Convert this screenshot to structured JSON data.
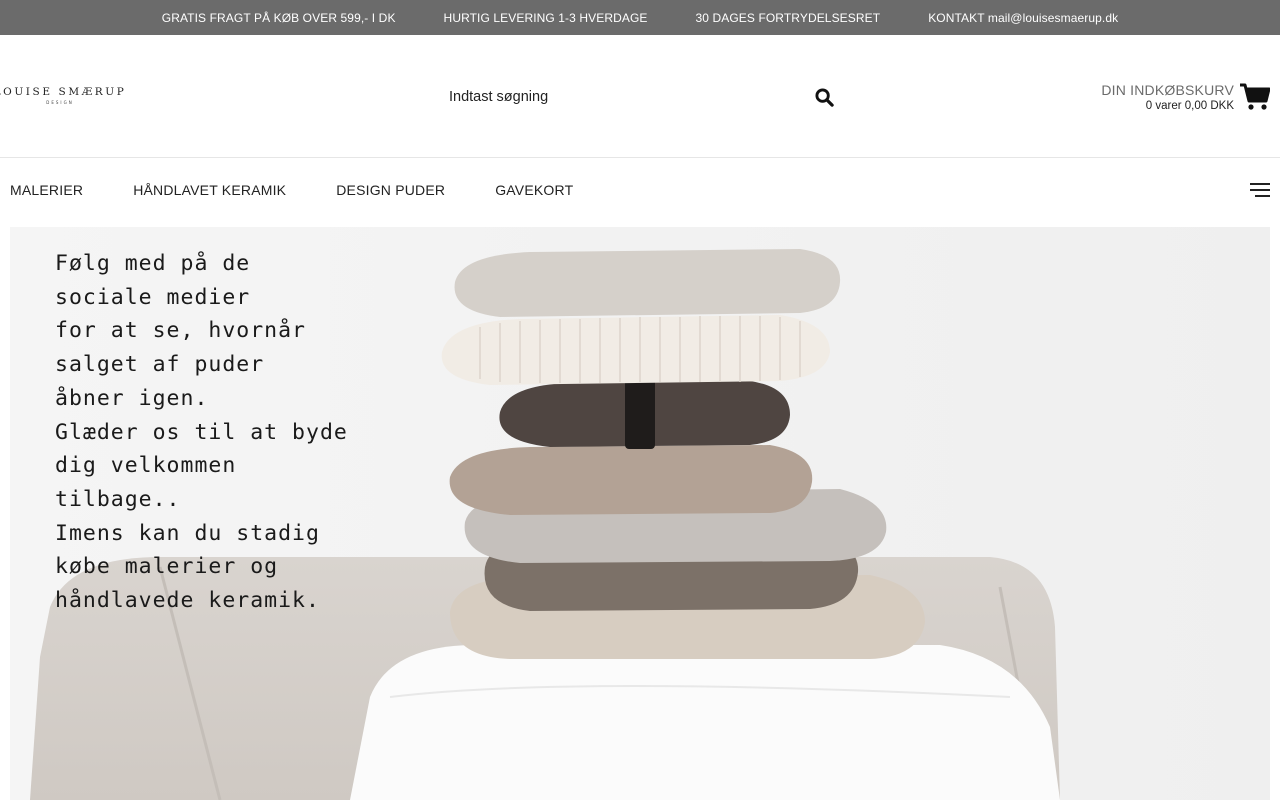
{
  "topbar": {
    "items": [
      "GRATIS FRAGT PÅ KØB OVER 599,- I DK",
      "HURTIG LEVERING 1-3 HVERDAGE",
      "30 DAGES FORTRYDELSESRET",
      "KONTAKT mail@louisesmaerup.dk"
    ]
  },
  "header": {
    "logo": {
      "main": "LOUISE SMÆRUP",
      "sub": "DESIGN"
    },
    "search": {
      "placeholder": "Indtast søgning",
      "icon": "search-icon"
    },
    "cart": {
      "title": "DIN INDKØBSKURV",
      "summary": "0 varer 0,00 DKK",
      "icon": "shopping-cart-icon"
    }
  },
  "nav": {
    "items": [
      "MALERIER",
      "HÅNDLAVET KERAMIK",
      "DESIGN PUDER",
      "GAVEKORT"
    ],
    "menu_icon": "hamburger-menu-icon"
  },
  "hero": {
    "lines": [
      "Følg med på de",
      "sociale medier",
      "for at se, hvornår",
      "salget af puder",
      "åbner igen.",
      "Glæder os til at byde",
      "dig velkommen",
      "tilbage..",
      "Imens kan du stadig",
      "købe malerier og",
      "håndlavede keramik."
    ]
  },
  "colors": {
    "topbar_bg": "#6b6b6b",
    "topbar_text": "#ffffff",
    "cart_title": "#6b6b6b",
    "text": "#222222"
  }
}
